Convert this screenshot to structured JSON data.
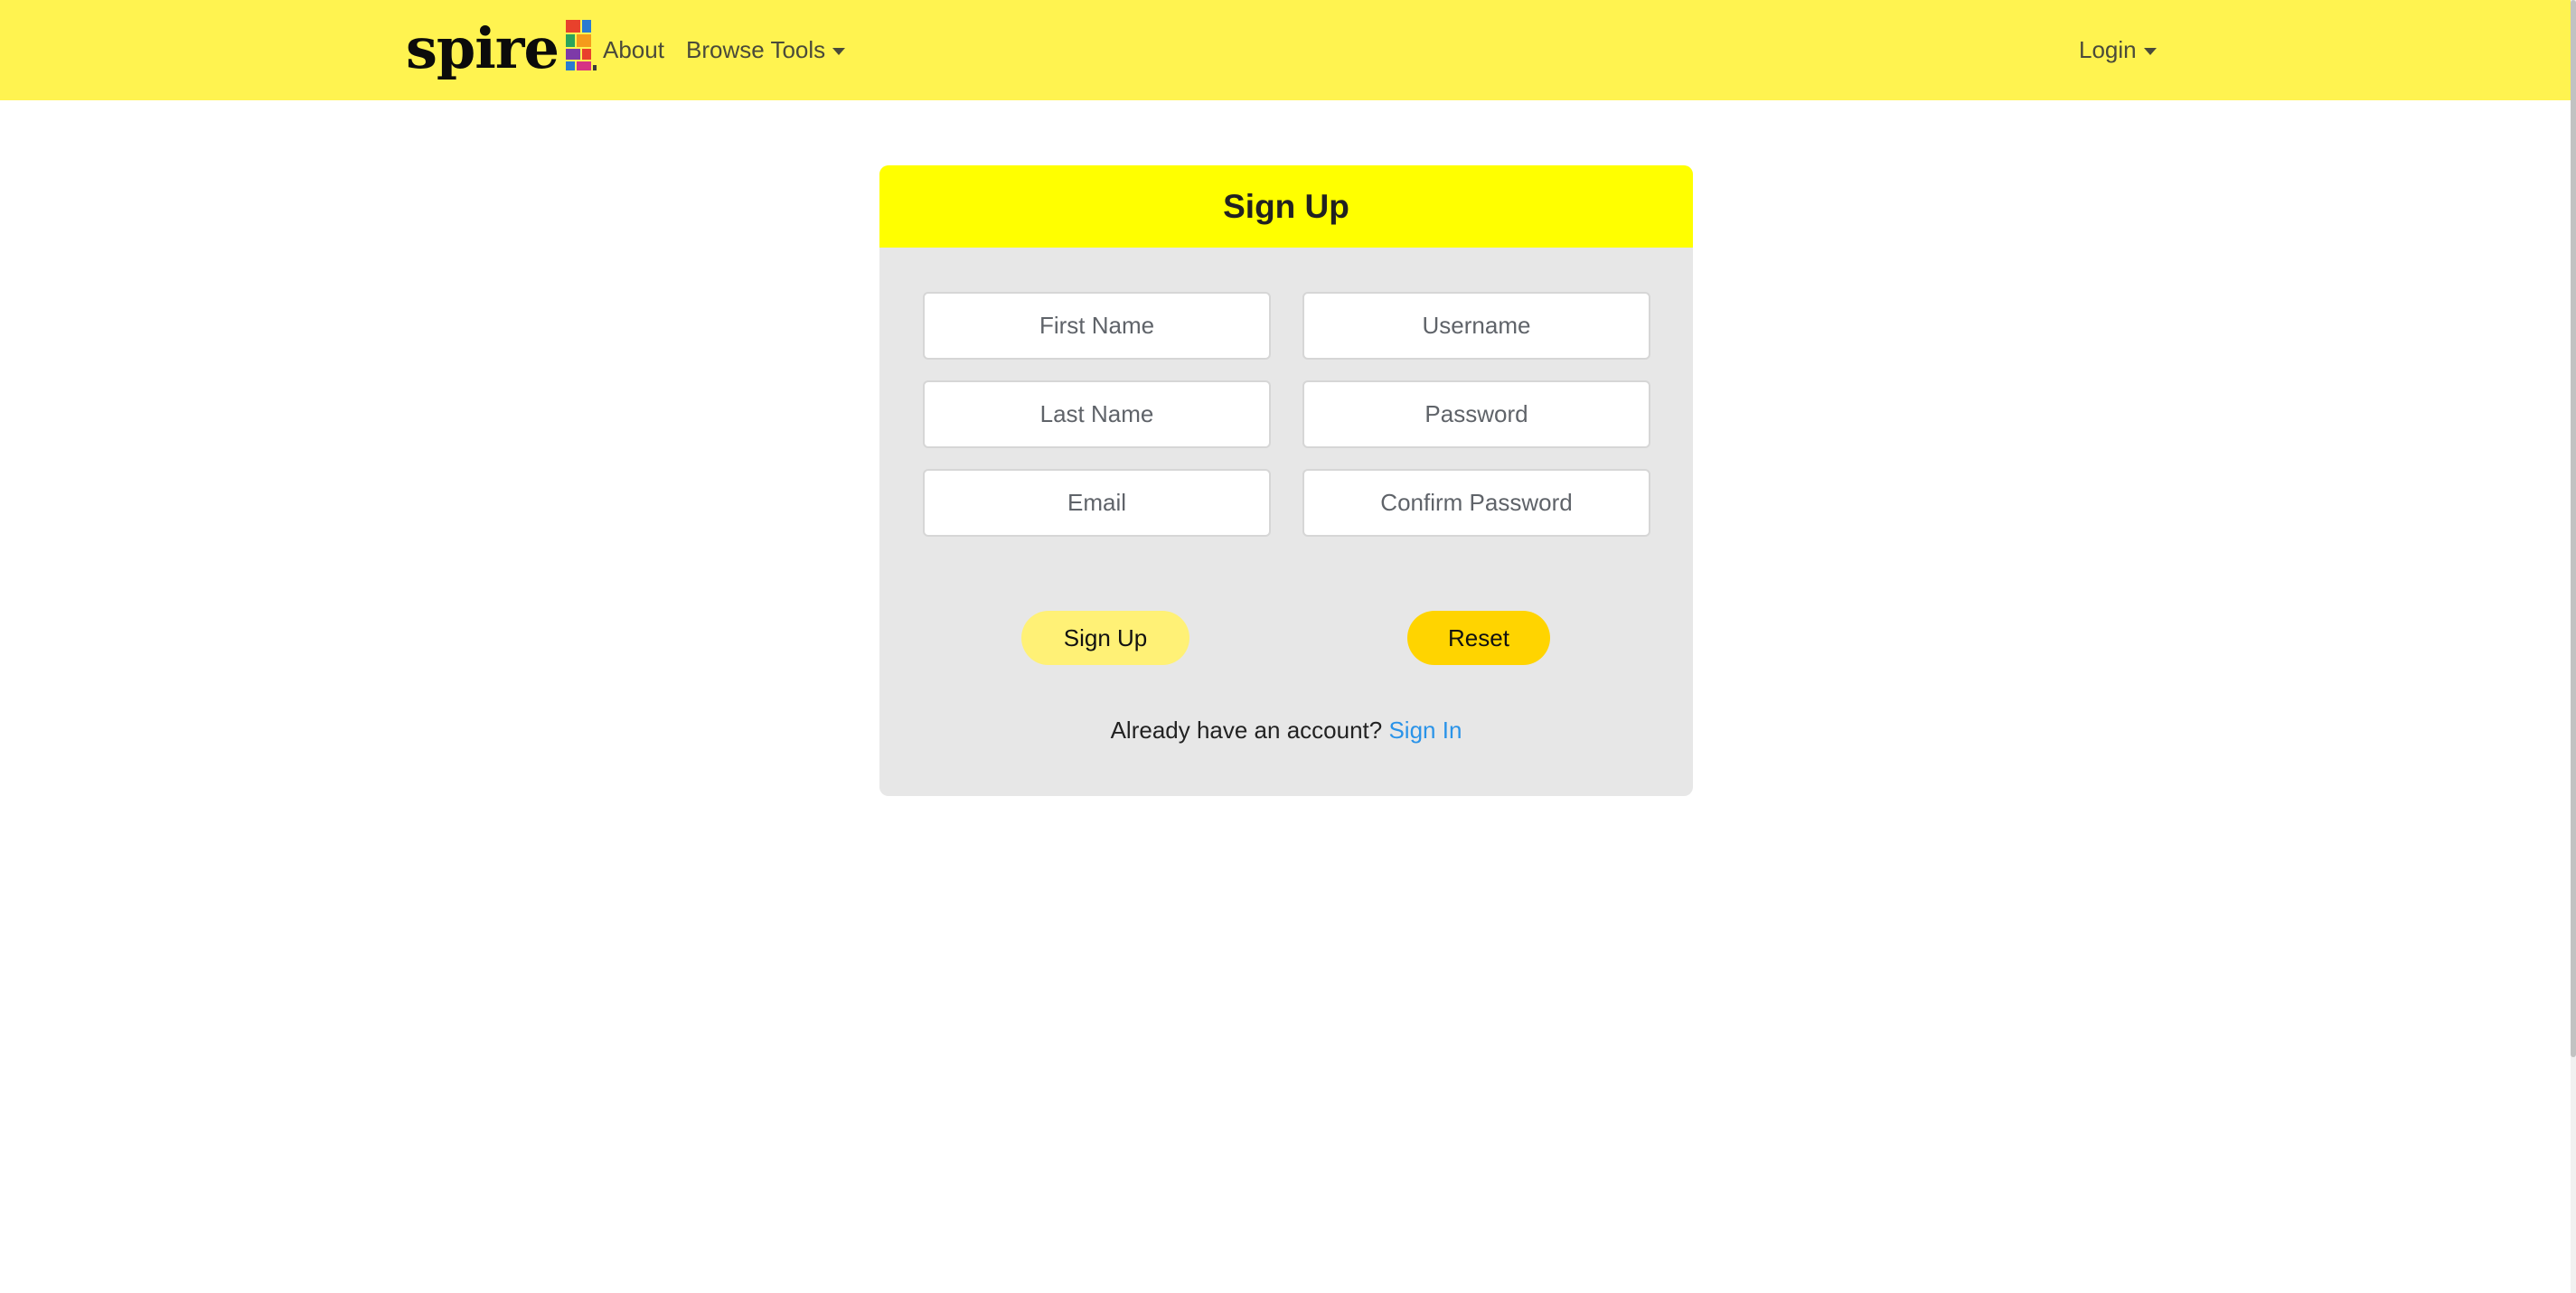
{
  "navbar": {
    "brand": "spire",
    "brand_mark_icon": "stained-glass-logo-icon",
    "links": {
      "about": "About",
      "browse_tools": "Browse Tools",
      "login": "Login"
    },
    "background_color": "#fff350"
  },
  "signup_card": {
    "title": "Sign Up",
    "header_color": "#ffff00",
    "fields": {
      "first_name": {
        "placeholder": "First Name",
        "value": ""
      },
      "username": {
        "placeholder": "Username",
        "value": ""
      },
      "last_name": {
        "placeholder": "Last Name",
        "value": ""
      },
      "password": {
        "placeholder": "Password",
        "value": ""
      },
      "email": {
        "placeholder": "Email",
        "value": ""
      },
      "confirm_password": {
        "placeholder": "Confirm Password",
        "value": ""
      }
    },
    "buttons": {
      "signup": "Sign Up",
      "reset": "Reset"
    },
    "switch_prompt": "Already have an account?",
    "switch_link": "Sign In",
    "link_color": "#2a93e8"
  }
}
